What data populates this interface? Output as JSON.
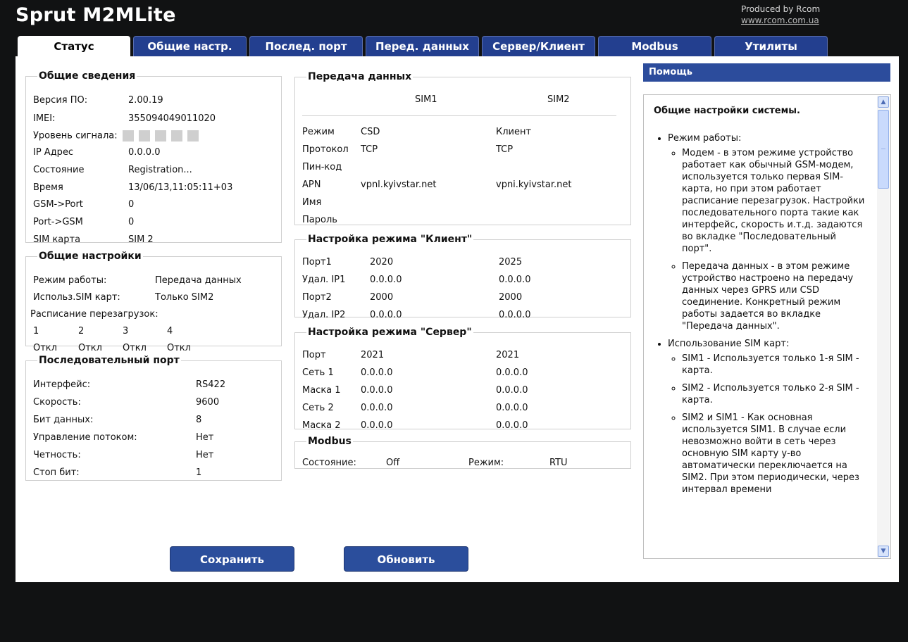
{
  "header": {
    "title": "Sprut M2MLite",
    "produced_by": "Produced by Rcom",
    "link": "www.rcom.com.ua"
  },
  "tabs": [
    "Статус",
    "Общие настр.",
    "Послед. порт",
    "Перед. данных",
    "Сервер/Клиент",
    "Modbus",
    "Утилиты"
  ],
  "general_info": {
    "legend": "Общие сведения",
    "rows": [
      {
        "label": "Версия ПО:",
        "value": "2.00.19"
      },
      {
        "label": "IMEI:",
        "value": "355094049011020"
      },
      {
        "label": "Уровень сигнала:",
        "value": ""
      },
      {
        "label": "IP Адрес",
        "value": "0.0.0.0"
      },
      {
        "label": "Состояние",
        "value": "Registration..."
      },
      {
        "label": "Время",
        "value": "13/06/13,11:05:11+03"
      },
      {
        "label": "GSM->Port",
        "value": "0"
      },
      {
        "label": "Port->GSM",
        "value": "0"
      },
      {
        "label": "SIM карта",
        "value": "SIM 2"
      }
    ],
    "signal_bars_total": 5,
    "signal_bars_active": 0
  },
  "general_settings": {
    "legend": "Общие настройки",
    "mode_label": "Режим работы:",
    "mode_value": "Передача данных",
    "sim_label": "Использ.SIM карт:",
    "sim_value": "Только SIM2",
    "reboot_label": "Расписание перезагрузок:",
    "schedule": [
      {
        "num": "1",
        "state": "Откл"
      },
      {
        "num": "2",
        "state": "Откл"
      },
      {
        "num": "3",
        "state": "Откл"
      },
      {
        "num": "4",
        "state": "Откл"
      }
    ]
  },
  "serial_port": {
    "legend": "Последовательный порт",
    "rows": [
      {
        "label": "Интерфейс:",
        "value": "RS422"
      },
      {
        "label": "Скорость:",
        "value": "9600"
      },
      {
        "label": "Бит данных:",
        "value": "8"
      },
      {
        "label": "Управление потоком:",
        "value": "Нет"
      },
      {
        "label": "Четность:",
        "value": "Нет"
      },
      {
        "label": "Стоп бит:",
        "value": "1"
      }
    ]
  },
  "data_transfer": {
    "legend": "Передача данных",
    "sim1": "SIM1",
    "sim2": "SIM2",
    "rows": [
      {
        "label": "Режим",
        "sim1": "CSD",
        "sim2": "Клиент"
      },
      {
        "label": "Протокол",
        "sim1": "TCP",
        "sim2": "TCP"
      },
      {
        "label": "Пин-код",
        "sim1": "",
        "sim2": ""
      },
      {
        "label": "APN",
        "sim1": "vpnl.kyivstar.net",
        "sim2": "vpni.kyivstar.net"
      },
      {
        "label": "Имя",
        "sim1": "",
        "sim2": ""
      },
      {
        "label": "Пароль",
        "sim1": "",
        "sim2": ""
      }
    ]
  },
  "client_mode": {
    "legend": "Настройка режима \"Клиент\"",
    "rows": [
      {
        "label": "Порт1",
        "sim1": "2020",
        "sim2": "2025"
      },
      {
        "label": "Удал. IP1",
        "sim1": "0.0.0.0",
        "sim2": "0.0.0.0"
      },
      {
        "label": "Порт2",
        "sim1": "2000",
        "sim2": "2000"
      },
      {
        "label": "Удал. IP2",
        "sim1": "0.0.0.0",
        "sim2": "0.0.0.0"
      }
    ]
  },
  "server_mode": {
    "legend": "Настройка режима \"Сервер\"",
    "rows": [
      {
        "label": "Порт",
        "sim1": "2021",
        "sim2": "2021"
      },
      {
        "label": "Сеть 1",
        "sim1": "0.0.0.0",
        "sim2": "0.0.0.0"
      },
      {
        "label": "Маска 1",
        "sim1": "0.0.0.0",
        "sim2": "0.0.0.0"
      },
      {
        "label": "Сеть 2",
        "sim1": "0.0.0.0",
        "sim2": "0.0.0.0"
      },
      {
        "label": "Маска 2",
        "sim1": "0.0.0.0",
        "sim2": "0.0.0.0"
      }
    ]
  },
  "modbus": {
    "legend": "Modbus",
    "state_label": "Состояние:",
    "state_value": "Off",
    "mode_label": "Режим:",
    "mode_value": "RTU"
  },
  "buttons": {
    "save": "Сохранить",
    "refresh": "Обновить"
  },
  "help": {
    "header": "Помощь",
    "title": "Общие настройки системы.",
    "items": [
      {
        "text": "Режим работы:",
        "sub": [
          "Модем - в этом режиме устройство работает как обычный GSM-модем, используется только первая SIM-карта, но при этом работает расписание перезагрузок. Настройки последовательного порта такие как интерфейс, скорость и.т.д. задаются во вкладке \"Последовательный порт\".",
          "Передача данных - в этом режиме устройство настроено на передачу данных через GPRS или CSD соединение. Конкретный режим работы задается во вкладке \"Передача данных\"."
        ]
      },
      {
        "text": "Использование SIM карт:",
        "sub": [
          "SIM1 - Используется только 1-я SIM - карта.",
          "SIM2 - Используется только 2-я SIM - карта.",
          "SIM2 и SIM1 - Как основная используется SIM1. В случае если невозможно войти в сеть через основную SIM карту у-во автоматически переключается на SIM2. При этом периодически, через интервал времени"
        ]
      }
    ]
  }
}
